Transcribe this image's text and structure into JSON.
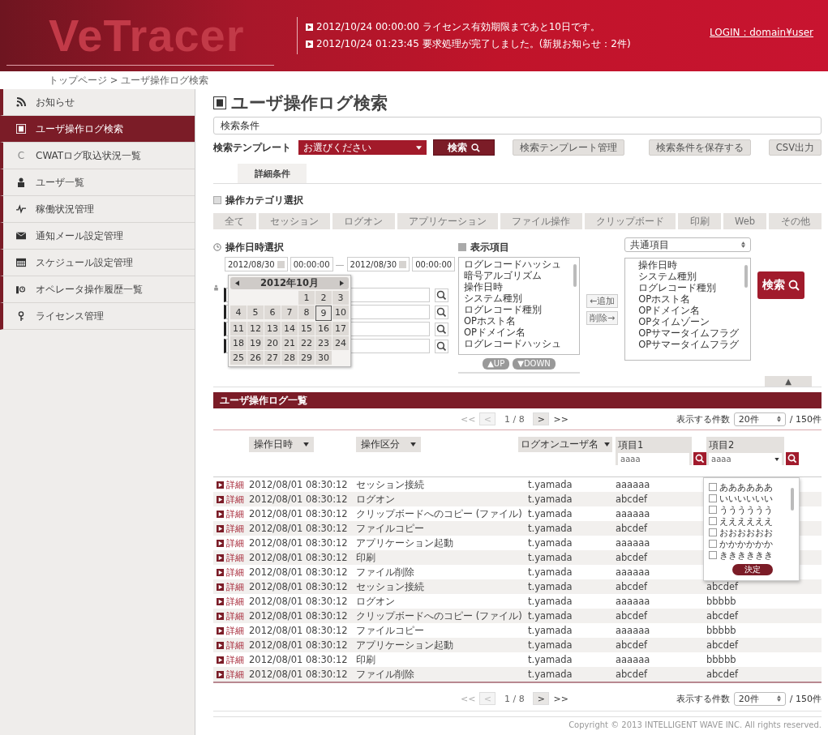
{
  "header": {
    "logo": "VeTracer",
    "notices": [
      {
        "text": "2012/10/24 00:00:00  ライセンス有効期限まであと10日です。"
      },
      {
        "text": "2012/10/24 01:23:45  要求処理が完了しました。(新規お知らせ：2件)"
      }
    ],
    "login": "LOGIN : domain¥user"
  },
  "breadcrumb": "トップページ > ユーザ操作ログ検索",
  "sidebar": {
    "items": [
      {
        "label": "お知らせ",
        "selected": false
      },
      {
        "label": "ユーザ操作ログ検索",
        "selected": true
      },
      {
        "label": "CWATログ取込状況一覧",
        "icon_text": "C",
        "selected": false
      },
      {
        "label": "ユーザ一覧",
        "selected": false
      },
      {
        "label": "稼働状況管理",
        "selected": false
      },
      {
        "label": "通知メール設定管理",
        "selected": false
      },
      {
        "label": "スケジュール設定管理",
        "selected": false
      },
      {
        "label": "オペレータ操作履歴一覧",
        "selected": false
      },
      {
        "label": "ライセンス管理",
        "selected": false
      }
    ]
  },
  "page_title": "ユーザ操作ログ検索",
  "conditions_label": "検索条件",
  "template": {
    "label": "検索テンプレート",
    "value": "お選びください",
    "search_button": "検索",
    "manage_button": "検索テンプレート管理",
    "save_button": "検索条件を保存する",
    "csv_button": "CSV出力"
  },
  "tabs": [
    {
      "label": "詳細条件",
      "selected": true
    }
  ],
  "category": {
    "title": "操作カテゴリ選択",
    "options": [
      {
        "label": "全て",
        "selected": false
      },
      {
        "label": "セッション",
        "selected": false
      },
      {
        "label": "ログオン",
        "selected": false
      },
      {
        "label": "アプリケーション",
        "selected": false
      },
      {
        "label": "ファイル操作",
        "selected": false
      },
      {
        "label": "クリップボード",
        "selected": false
      },
      {
        "label": "印刷",
        "selected": false
      },
      {
        "label": "Web",
        "selected": false
      },
      {
        "label": "その他",
        "selected": false
      }
    ]
  },
  "datetime": {
    "title": "操作日時選択",
    "from_date": "2012/08/30",
    "from_time": "00:00:00",
    "separator": "—",
    "to_date": "2012/08/30",
    "to_time": "00:00:00"
  },
  "calendar": {
    "month": "2012年10月",
    "weeks": [
      {
        "kind": "partial_start",
        "days": [
          {
            "day": "1",
            "selected": false
          },
          {
            "day": "2",
            "selected": false
          },
          {
            "day": "3",
            "selected": false
          }
        ]
      },
      {
        "kind": "full",
        "days": [
          {
            "day": "4",
            "selected": false
          },
          {
            "day": "5",
            "selected": false
          },
          {
            "day": "6",
            "selected": false
          },
          {
            "day": "7",
            "selected": false
          },
          {
            "day": "8",
            "selected": false
          },
          {
            "day": "9",
            "selected": true
          },
          {
            "day": "10",
            "selected": false
          }
        ]
      },
      {
        "kind": "full",
        "days": [
          {
            "day": "11",
            "selected": false
          },
          {
            "day": "12",
            "selected": false
          },
          {
            "day": "13",
            "selected": false
          },
          {
            "day": "14",
            "selected": false
          },
          {
            "day": "15",
            "selected": false
          },
          {
            "day": "16",
            "selected": false
          },
          {
            "day": "17",
            "selected": false
          }
        ]
      },
      {
        "kind": "full",
        "days": [
          {
            "day": "18",
            "selected": false
          },
          {
            "day": "19",
            "selected": false
          },
          {
            "day": "20",
            "selected": false
          },
          {
            "day": "21",
            "selected": false
          },
          {
            "day": "22",
            "selected": false
          },
          {
            "day": "23",
            "selected": false
          },
          {
            "day": "24",
            "selected": false
          }
        ]
      },
      {
        "kind": "partial_end",
        "days": [
          {
            "day": "25",
            "selected": false
          },
          {
            "day": "26",
            "selected": false
          },
          {
            "day": "27",
            "selected": false
          },
          {
            "day": "28",
            "selected": false
          },
          {
            "day": "29",
            "selected": false
          },
          {
            "day": "30",
            "selected": false
          }
        ]
      }
    ]
  },
  "display_items": {
    "title": "表示項目",
    "available": [
      "ログレコードハッシュ",
      "暗号アルゴリズム",
      "操作日時",
      "システム種別",
      "ログレコード種別",
      "OPホスト名",
      "OPドメイン名",
      "ログレコードハッシュ"
    ],
    "up_button": "▲UP",
    "down_button": "▼DOWN",
    "add_button": "←追加",
    "remove_button": "削除→",
    "group": "共通項目",
    "chosen": [
      "操作日時",
      "システム種別",
      "ログレコード種別",
      "OPホスト名",
      "OPドメイン名",
      "OPタイムゾーン",
      "OPサマータイムフラグ",
      "OPサマータイムフラグ"
    ],
    "search_button": "検索",
    "collapse_button": "▲"
  },
  "results": {
    "title": "ユーザ操作ログ一覧",
    "pager_top": {
      "first": "<<",
      "prev": "<",
      "page": "1 / 8",
      "next": ">",
      "last": ">>",
      "per_page_label": "表示する件数",
      "per_page": "20件",
      "total": "/ 150件"
    },
    "columns": [
      {
        "label": "操作日時",
        "kind": "sort"
      },
      {
        "label": "操作区分",
        "kind": "sort"
      },
      {
        "label": "ログオンユーザ名",
        "kind": "sort"
      },
      {
        "label": "項目1",
        "kind": "filter",
        "value": "aaaa"
      },
      {
        "label": "項目2",
        "kind": "dropdown",
        "value": "aaaa"
      }
    ],
    "rows": [
      {
        "detail": "詳細",
        "date": "2012/08/01",
        "time": "08:30:12",
        "type": "セッション接続",
        "user": "t.yamada",
        "item1": "aaaaaa"
      },
      {
        "detail": "詳細",
        "date": "2012/08/01",
        "time": "08:30:12",
        "type": "ログオン",
        "user": "t.yamada",
        "item1": "abcdef"
      },
      {
        "detail": "詳細",
        "date": "2012/08/01",
        "time": "08:30:12",
        "type": "クリップボードへのコピー (ファイル)",
        "user": "t.yamada",
        "item1": "aaaaaa"
      },
      {
        "detail": "詳細",
        "date": "2012/08/01",
        "time": "08:30:12",
        "type": "ファイルコピー",
        "user": "t.yamada",
        "item1": "abcdef"
      },
      {
        "detail": "詳細",
        "date": "2012/08/01",
        "time": "08:30:12",
        "type": "アプリケーション起動",
        "user": "t.yamada",
        "item1": "aaaaaa"
      },
      {
        "detail": "詳細",
        "date": "2012/08/01",
        "time": "08:30:12",
        "type": "印刷",
        "user": "t.yamada",
        "item1": "abcdef"
      },
      {
        "detail": "詳細",
        "date": "2012/08/01",
        "time": "08:30:12",
        "type": "ファイル削除",
        "user": "t.yamada",
        "item1": "aaaaaa"
      },
      {
        "detail": "詳細",
        "date": "2012/08/01",
        "time": "08:30:12",
        "type": "セッション接続",
        "user": "t.yamada",
        "item1": "abcdef",
        "item2": "abcdef"
      },
      {
        "detail": "詳細",
        "date": "2012/08/01",
        "time": "08:30:12",
        "type": "ログオン",
        "user": "t.yamada",
        "item1": "aaaaaa",
        "item2": "bbbbb"
      },
      {
        "detail": "詳細",
        "date": "2012/08/01",
        "time": "08:30:12",
        "type": "クリップボードへのコピー (ファイル)",
        "user": "t.yamada",
        "item1": "abcdef",
        "item2": "abcdef"
      },
      {
        "detail": "詳細",
        "date": "2012/08/01",
        "time": "08:30:12",
        "type": "ファイルコピー",
        "user": "t.yamada",
        "item1": "aaaaaa",
        "item2": "bbbbb"
      },
      {
        "detail": "詳細",
        "date": "2012/08/01",
        "time": "08:30:12",
        "type": "アプリケーション起動",
        "user": "t.yamada",
        "item1": "abcdef",
        "item2": "abcdef"
      },
      {
        "detail": "詳細",
        "date": "2012/08/01",
        "time": "08:30:12",
        "type": "印刷",
        "user": "t.yamada",
        "item1": "aaaaaa",
        "item2": "bbbbb"
      },
      {
        "detail": "詳細",
        "date": "2012/08/01",
        "time": "08:30:12",
        "type": "ファイル削除",
        "user": "t.yamada",
        "item1": "abcdef",
        "item2": "abcdef"
      }
    ],
    "dropdown": {
      "options": [
        {
          "label": "ああああああ",
          "checked": false
        },
        {
          "label": "いいいいいい",
          "checked": false
        },
        {
          "label": "うううううう",
          "checked": false
        },
        {
          "label": "ええええええ",
          "checked": false
        },
        {
          "label": "おおおおおお",
          "checked": false
        },
        {
          "label": "かかかかかか",
          "checked": false
        },
        {
          "label": "きききききき",
          "checked": false
        }
      ],
      "button": "決定"
    },
    "pager_bottom": {
      "first": "<<",
      "prev": "<",
      "page": "1 / 8",
      "next": ">",
      "last": ">>",
      "per_page_label": "表示する件数",
      "per_page": "20件",
      "total": "/ 150件"
    }
  },
  "footer": "Copyright © 2013 INTELLIGENT WAVE INC. All rights reserved."
}
